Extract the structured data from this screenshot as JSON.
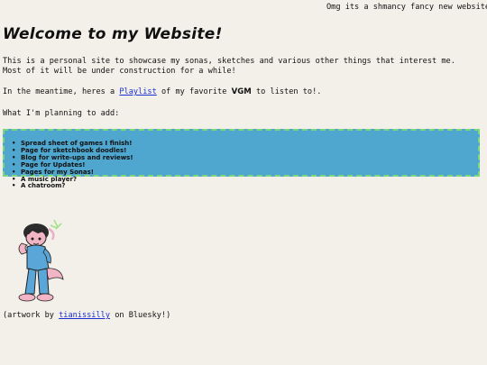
{
  "marquee": {
    "text": "Omg its a shmancy fancy new website! ]"
  },
  "header": {
    "title": "Welcome to my Website!"
  },
  "intro": {
    "line1": "This is a personal site to showcase my sonas, sketches and various other things that interest me.",
    "line2": "Most of it will be under construction for a while!"
  },
  "listen": {
    "prefix": "In the meantime, heres a ",
    "link_text": "Playlist",
    "middle": " of my favorite ",
    "vgm": "VGM",
    "suffix": " to listen to!."
  },
  "planning": {
    "heading": "What I'm planning to add:",
    "items": [
      "Spread sheet of games I finish!",
      "Page for sketchbook doodles!",
      "Blog for write-ups and reviews!",
      "Page for Updates!",
      "Pages for my Sonas!",
      "A music player?",
      "A chatroom?"
    ],
    "bullet": "•"
  },
  "credit": {
    "prefix": "(artwork by ",
    "artist": "tianissilly",
    "suffix": " on Bluesky!)"
  },
  "colors": {
    "background": "#f3f0e9",
    "plan_box": "#4fa6cf",
    "plan_border": "#7fd67a",
    "link": "#1a2fd0"
  },
  "icons": {
    "artwork": "sona-character-illustration"
  }
}
